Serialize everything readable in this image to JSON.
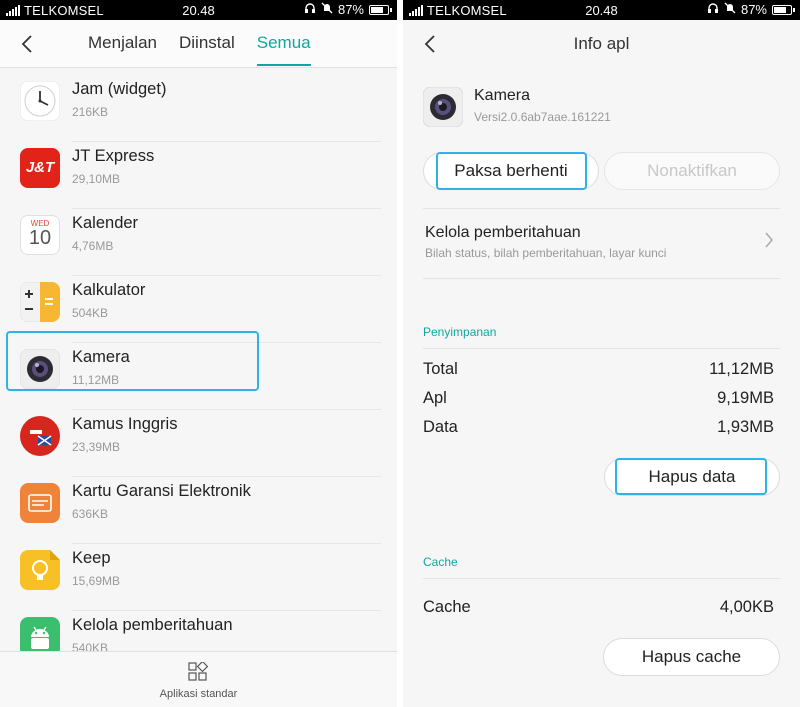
{
  "left_screen": {
    "status_bar": {
      "carrier": "TELKOMSEL",
      "time": "20.48",
      "battery": "87%"
    },
    "tabs": [
      {
        "label": "Menjalan"
      },
      {
        "label": "Diinstal"
      },
      {
        "label": "Semua"
      }
    ],
    "active_tab": "Semua",
    "apps": [
      {
        "name": "Jam (widget)",
        "size": "216KB"
      },
      {
        "name": "JT Express",
        "size": "29,10MB"
      },
      {
        "name": "Kalender",
        "size": "4,76MB",
        "icon_day": "WED",
        "icon_date": "10"
      },
      {
        "name": "Kalkulator",
        "size": "504KB"
      },
      {
        "name": "Kamera",
        "size": "11,12MB"
      },
      {
        "name": "Kamus Inggris",
        "size": "23,39MB"
      },
      {
        "name": "Kartu Garansi Elektronik",
        "size": "636KB"
      },
      {
        "name": "Keep",
        "size": "15,69MB"
      },
      {
        "name": "Kelola pemberitahuan",
        "size": "540KB"
      }
    ],
    "jt_icon_text": "J&T",
    "bottom_bar": {
      "label": "Aplikasi standar"
    }
  },
  "right_screen": {
    "status_bar": {
      "carrier": "TELKOMSEL",
      "time": "20.48",
      "battery": "87%"
    },
    "title": "Info apl",
    "app": {
      "name": "Kamera",
      "version": "Versi2.0.6ab7aae.161221"
    },
    "buttons": {
      "force_stop": "Paksa berhenti",
      "disable": "Nonaktifkan",
      "clear_data": "Hapus data",
      "clear_cache": "Hapus cache"
    },
    "notification_setting": {
      "title": "Kelola pemberitahuan",
      "subtitle": "Bilah status, bilah pemberitahuan, layar kunci"
    },
    "storage": {
      "section_label": "Penyimpanan",
      "rows": [
        {
          "label": "Total",
          "value": "11,12MB"
        },
        {
          "label": "Apl",
          "value": "9,19MB"
        },
        {
          "label": "Data",
          "value": "1,93MB"
        }
      ]
    },
    "cache": {
      "section_label": "Cache",
      "label": "Cache",
      "value": "4,00KB"
    }
  },
  "colors": {
    "accent": "#12a6a0",
    "highlight": "#2eb3e4",
    "jt_red": "#e2231a"
  }
}
